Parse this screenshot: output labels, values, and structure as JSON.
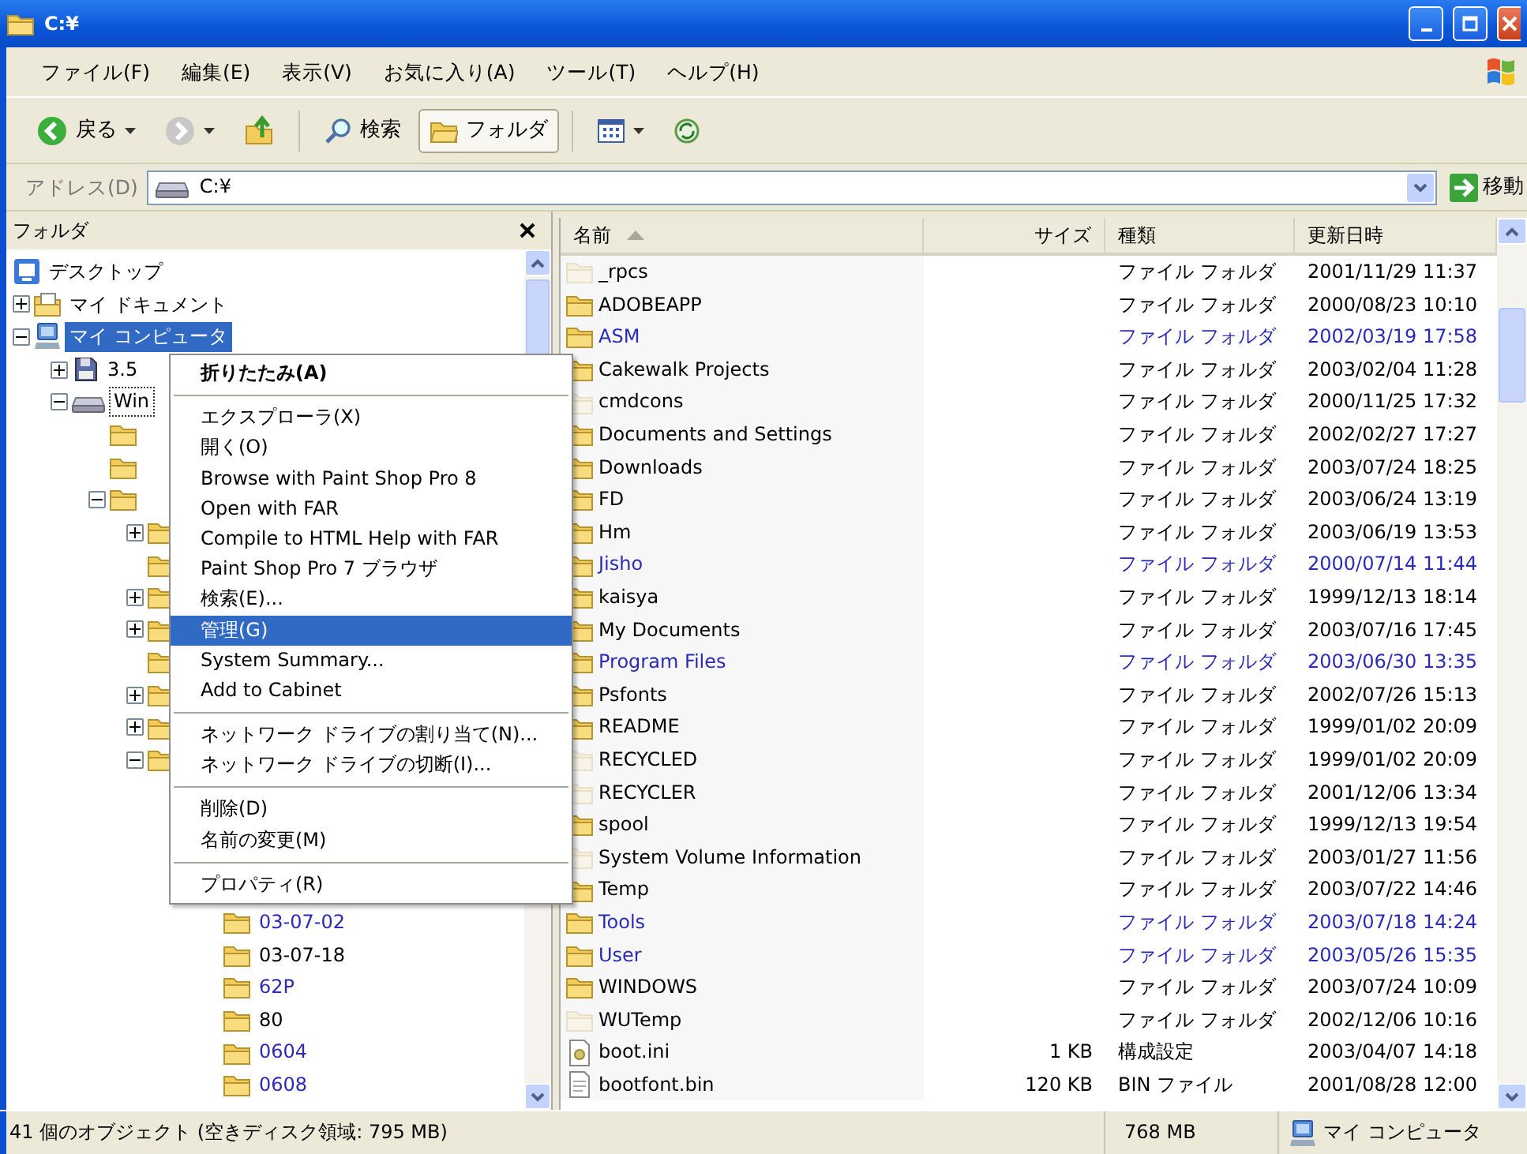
{
  "window": {
    "title": "C:¥"
  },
  "menu_bar": [
    "ファイル(F)",
    "編集(E)",
    "表示(V)",
    "お気に入り(A)",
    "ツール(T)",
    "ヘルプ(H)"
  ],
  "toolbar": [
    {
      "kind": "back",
      "label": "戻る",
      "disabled": false
    },
    {
      "kind": "forward",
      "disabled": true
    },
    {
      "kind": "up"
    },
    {
      "kind": "separator"
    },
    {
      "kind": "search",
      "label": "検索",
      "pressed": false
    },
    {
      "kind": "folders",
      "label": "フォルダ",
      "pressed": true
    },
    {
      "kind": "separator"
    },
    {
      "kind": "views"
    },
    {
      "kind": "sync"
    }
  ],
  "address_bar": {
    "label": "アドレス(D)",
    "value": "C:¥",
    "go_label": "移動"
  },
  "folder_pane": {
    "title": "フォルダ",
    "tree": [
      {
        "label": "デスクトップ",
        "kind": "desktop",
        "selected": false,
        "children": [
          {
            "label": "マイ ドキュメント",
            "kind": "documents",
            "selected": false,
            "expanded": false
          },
          {
            "label": "マイ コンピュータ",
            "kind": "computer",
            "selected": true,
            "expanded": true,
            "children": [
              {
                "label": "3.5",
                "kind": "floppy",
                "selected": false,
                "expanded": false
              },
              {
                "label": "Win",
                "kind": "drive",
                "selected": false,
                "focused": true,
                "expanded": true,
                "children": [
                  {
                    "kind": "folder"
                  },
                  {
                    "kind": "folder"
                  },
                  {
                    "kind": "folder",
                    "expanded": true,
                    "children": [
                      {
                        "kind": "folder",
                        "expanded": false
                      },
                      {
                        "kind": "folder"
                      },
                      {
                        "kind": "folder",
                        "expanded": false
                      },
                      {
                        "kind": "folder",
                        "expanded": false
                      },
                      {
                        "kind": "folder"
                      },
                      {
                        "kind": "folder",
                        "expanded": false
                      },
                      {
                        "kind": "folder",
                        "expanded": false
                      },
                      {
                        "kind": "folder",
                        "expanded": true,
                        "children": [
                          {
                            "children": [
                              {
                                "label": "03-07-02",
                                "kind": "folder",
                                "selected": false,
                                "compressed": true
                              },
                              {
                                "label": "03-07-18",
                                "kind": "folder",
                                "selected": false,
                                "compressed": false
                              },
                              {
                                "label": "62P",
                                "kind": "folder",
                                "selected": false,
                                "compressed": true
                              },
                              {
                                "label": "80",
                                "kind": "folder",
                                "selected": false,
                                "compressed": false
                              },
                              {
                                "label": "0604",
                                "kind": "folder",
                                "selected": false,
                                "compressed": true
                              },
                              {
                                "label": "0608",
                                "kind": "folder",
                                "selected": false,
                                "compressed": true
                              }
                            ]
                          }
                        ]
                      }
                    ]
                  }
                ]
              }
            ]
          }
        ]
      }
    ]
  },
  "context_menu": [
    {
      "kind": "item",
      "label": "折りたたみ(A)",
      "default": true,
      "selected": false
    },
    {
      "kind": "separator"
    },
    {
      "kind": "item",
      "label": "エクスプローラ(X)",
      "selected": false
    },
    {
      "kind": "item",
      "label": "開く(O)",
      "selected": false
    },
    {
      "kind": "item",
      "label": "Browse with Paint Shop Pro 8",
      "selected": false
    },
    {
      "kind": "item",
      "label": "Open with FAR",
      "selected": false
    },
    {
      "kind": "item",
      "label": "Compile to HTML Help with FAR",
      "selected": false
    },
    {
      "kind": "item",
      "label": "Paint Shop Pro 7 ブラウザ",
      "selected": false
    },
    {
      "kind": "item",
      "label": "検索(E)...",
      "selected": false
    },
    {
      "kind": "item",
      "label": "管理(G)",
      "selected": true
    },
    {
      "kind": "item",
      "label": "System Summary...",
      "selected": false
    },
    {
      "kind": "item",
      "label": "Add to Cabinet",
      "selected": false
    },
    {
      "kind": "separator"
    },
    {
      "kind": "item",
      "label": "ネットワーク ドライブの割り当て(N)...",
      "selected": false
    },
    {
      "kind": "item",
      "label": "ネットワーク ドライブの切断(I)...",
      "selected": false
    },
    {
      "kind": "separator"
    },
    {
      "kind": "item",
      "label": "削除(D)",
      "selected": false
    },
    {
      "kind": "item",
      "label": "名前の変更(M)",
      "selected": false
    },
    {
      "kind": "separator"
    },
    {
      "kind": "item",
      "label": "プロパティ(R)",
      "selected": false
    }
  ],
  "file_list": {
    "columns": [
      "名前",
      "サイズ",
      "種類",
      "更新日時"
    ],
    "rows": [
      {
        "name": "_rpcs",
        "type": "ファイル フォルダ",
        "modified": "2001/11/29 11:37",
        "kind": "folder",
        "hidden": true,
        "compressed": false
      },
      {
        "name": "ADOBEAPP",
        "type": "ファイル フォルダ",
        "modified": "2000/08/23 10:10",
        "kind": "folder",
        "hidden": false,
        "compressed": false
      },
      {
        "name": "ASM",
        "type": "ファイル フォルダ",
        "modified": "2002/03/19 17:58",
        "kind": "folder",
        "hidden": false,
        "compressed": true
      },
      {
        "name": "Cakewalk Projects",
        "type": "ファイル フォルダ",
        "modified": "2003/02/04 11:28",
        "kind": "folder",
        "hidden": false,
        "compressed": false
      },
      {
        "name": "cmdcons",
        "type": "ファイル フォルダ",
        "modified": "2000/11/25 17:32",
        "kind": "folder",
        "hidden": true,
        "compressed": false
      },
      {
        "name": "Documents and Settings",
        "type": "ファイル フォルダ",
        "modified": "2002/02/27 17:27",
        "kind": "folder",
        "hidden": false,
        "compressed": false
      },
      {
        "name": "Downloads",
        "type": "ファイル フォルダ",
        "modified": "2003/07/24 18:25",
        "kind": "folder",
        "hidden": false,
        "compressed": false
      },
      {
        "name": "FD",
        "type": "ファイル フォルダ",
        "modified": "2003/06/24 13:19",
        "kind": "folder",
        "hidden": false,
        "compressed": false
      },
      {
        "name": "Hm",
        "type": "ファイル フォルダ",
        "modified": "2003/06/19 13:53",
        "kind": "folder",
        "hidden": false,
        "compressed": false
      },
      {
        "name": "Jisho",
        "type": "ファイル フォルダ",
        "modified": "2000/07/14 11:44",
        "kind": "folder",
        "hidden": false,
        "compressed": true
      },
      {
        "name": "kaisya",
        "type": "ファイル フォルダ",
        "modified": "1999/12/13 18:14",
        "kind": "folder",
        "hidden": false,
        "compressed": false
      },
      {
        "name": "My Documents",
        "type": "ファイル フォルダ",
        "modified": "2003/07/16 17:45",
        "kind": "folder",
        "hidden": false,
        "compressed": false
      },
      {
        "name": "Program Files",
        "type": "ファイル フォルダ",
        "modified": "2003/06/30 13:35",
        "kind": "folder",
        "hidden": false,
        "compressed": true
      },
      {
        "name": "Psfonts",
        "type": "ファイル フォルダ",
        "modified": "2002/07/26 15:13",
        "kind": "folder",
        "hidden": false,
        "compressed": false
      },
      {
        "name": "README",
        "type": "ファイル フォルダ",
        "modified": "1999/01/02 20:09",
        "kind": "folder",
        "hidden": false,
        "compressed": false
      },
      {
        "name": "RECYCLED",
        "type": "ファイル フォルダ",
        "modified": "1999/01/02 20:09",
        "kind": "folder",
        "hidden": true,
        "compressed": false
      },
      {
        "name": "RECYCLER",
        "type": "ファイル フォルダ",
        "modified": "2001/12/06 13:34",
        "kind": "folder",
        "hidden": true,
        "compressed": false
      },
      {
        "name": "spool",
        "type": "ファイル フォルダ",
        "modified": "1999/12/13 19:54",
        "kind": "folder",
        "hidden": false,
        "compressed": false
      },
      {
        "name": "System Volume Information",
        "type": "ファイル フォルダ",
        "modified": "2003/01/27 11:56",
        "kind": "folder",
        "hidden": true,
        "compressed": false
      },
      {
        "name": "Temp",
        "type": "ファイル フォルダ",
        "modified": "2003/07/22 14:46",
        "kind": "folder",
        "hidden": false,
        "compressed": false
      },
      {
        "name": "Tools",
        "type": "ファイル フォルダ",
        "modified": "2003/07/18 14:24",
        "kind": "folder",
        "hidden": false,
        "compressed": true
      },
      {
        "name": "User",
        "type": "ファイル フォルダ",
        "modified": "2003/05/26 15:35",
        "kind": "folder",
        "hidden": false,
        "compressed": true
      },
      {
        "name": "WINDOWS",
        "type": "ファイル フォルダ",
        "modified": "2003/07/24 10:09",
        "kind": "folder",
        "hidden": false,
        "compressed": false
      },
      {
        "name": "WUTemp",
        "type": "ファイル フォルダ",
        "modified": "2002/12/06 10:16",
        "kind": "folder",
        "hidden": true,
        "compressed": false
      },
      {
        "name": "boot.ini",
        "size": "1 KB",
        "type": "構成設定",
        "modified": "2003/04/07 14:18",
        "kind": "settings_file",
        "hidden": false,
        "compressed": false
      },
      {
        "name": "bootfont.bin",
        "size": "120 KB",
        "type": "BIN ファイル",
        "modified": "2001/08/28 12:00",
        "kind": "file",
        "hidden": false,
        "compressed": false
      }
    ]
  },
  "status_bar": {
    "objects": "41 個のオブジェクト (空きディスク領域: 795 MB)",
    "size": "768 MB",
    "zone": "マイ コンピュータ"
  }
}
